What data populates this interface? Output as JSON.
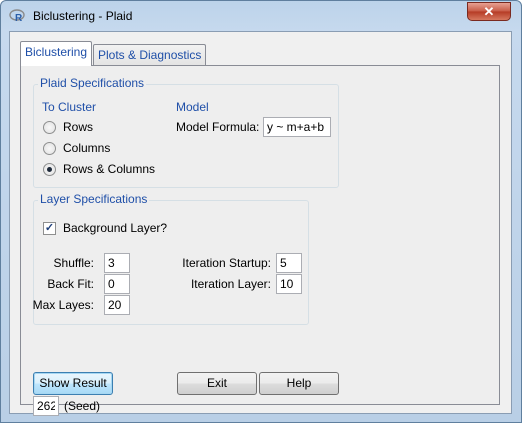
{
  "window": {
    "title": "Biclustering - Plaid",
    "close_label": "✕"
  },
  "tabs": [
    {
      "label": "Biclustering",
      "active": true
    },
    {
      "label": "Plots & Diagnostics",
      "active": false
    }
  ],
  "plaid_specifications": {
    "title": "Plaid Specifications",
    "to_cluster": {
      "heading": "To Cluster",
      "options": [
        "Rows",
        "Columns",
        "Rows & Columns"
      ],
      "selected": "Rows & Columns"
    },
    "model": {
      "heading": "Model",
      "formula_label": "Model Formula:",
      "formula_value": "y ~ m+a+b"
    }
  },
  "layer_specifications": {
    "title": "Layer Specifications",
    "background_layer_label": "Background Layer?",
    "background_layer_checked": true,
    "shuffle_label": "Shuffle:",
    "shuffle_value": "3",
    "back_fit_label": "Back Fit:",
    "back_fit_value": "0",
    "max_layes_label": "Max Layes:",
    "max_layes_value": "20",
    "iteration_startup_label": "Iteration Startup:",
    "iteration_startup_value": "5",
    "iteration_layer_label": "Iteration Layer:",
    "iteration_layer_value": "10"
  },
  "buttons": {
    "show_result": "Show Result",
    "exit": "Exit",
    "help": "Help"
  },
  "seed": {
    "value": "262",
    "label": "(Seed)"
  },
  "colors": {
    "accent_text": "#1f4fa8",
    "titlebar": "#c6d9ee",
    "close_button": "#c75a45"
  }
}
